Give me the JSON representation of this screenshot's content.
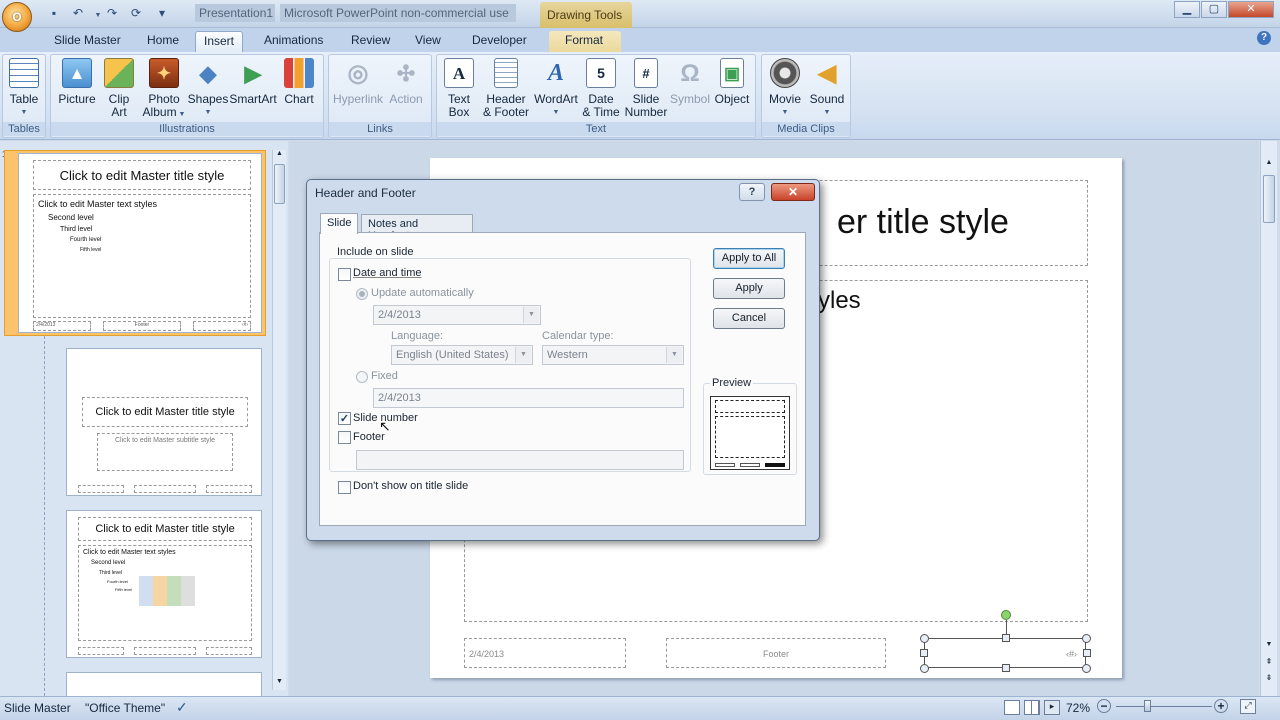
{
  "title_bar": {
    "presentation": "Presentation1",
    "app": "Microsoft PowerPoint non-commercial use",
    "contextual_tools": "Drawing Tools",
    "office_button": "O",
    "quick_access": [
      "save-icon",
      "undo-icon",
      "redo-icon",
      "repeat-icon",
      "customize-icon"
    ],
    "window_controls": [
      "minimize",
      "maximize",
      "close"
    ]
  },
  "tabs": [
    "Slide Master",
    "Home",
    "Insert",
    "Animations",
    "Review",
    "View",
    "Developer",
    "Format"
  ],
  "active_tab": "Insert",
  "ribbon": {
    "groups": [
      {
        "label": "Tables",
        "buttons": [
          {
            "label": "Table",
            "icon": "table-icon"
          }
        ]
      },
      {
        "label": "Illustrations",
        "buttons": [
          {
            "label": "Picture",
            "icon": "picture-icon"
          },
          {
            "label": "Clip",
            "label2": "Art",
            "icon": "clip-art-icon"
          },
          {
            "label": "Photo",
            "label2": "Album",
            "icon": "photo-album-icon"
          },
          {
            "label": "Shapes",
            "icon": "shapes-icon"
          },
          {
            "label": "SmartArt",
            "icon": "smartart-icon"
          },
          {
            "label": "Chart",
            "icon": "chart-icon"
          }
        ]
      },
      {
        "label": "Links",
        "buttons": [
          {
            "label": "Hyperlink",
            "icon": "hyperlink-icon",
            "disabled": true
          },
          {
            "label": "Action",
            "icon": "action-icon",
            "disabled": true
          }
        ]
      },
      {
        "label": "Text",
        "buttons": [
          {
            "label": "Text",
            "label2": "Box",
            "icon": "text-box-icon"
          },
          {
            "label": "Header",
            "label2": "& Footer",
            "icon": "header-footer-icon"
          },
          {
            "label": "WordArt",
            "icon": "wordart-icon"
          },
          {
            "label": "Date",
            "label2": "& Time",
            "icon": "date-time-icon"
          },
          {
            "label": "Slide",
            "label2": "Number",
            "icon": "slide-number-icon"
          },
          {
            "label": "Symbol",
            "icon": "symbol-icon",
            "disabled": true
          },
          {
            "label": "Object",
            "icon": "object-icon"
          }
        ]
      },
      {
        "label": "Media Clips",
        "buttons": [
          {
            "label": "Movie",
            "icon": "movie-icon"
          },
          {
            "label": "Sound",
            "icon": "sound-icon"
          }
        ]
      }
    ]
  },
  "thumbnails": {
    "master": {
      "number": "1",
      "title": "Click to edit Master title style",
      "levels": [
        "Click to edit Master text styles",
        "Second level",
        "Third level",
        "Fourth level",
        "Fifth level"
      ],
      "footer_date": "2/4/2013",
      "footer_mid": "Footer",
      "footer_num": "‹#›"
    },
    "title_layout": {
      "title": "Click to edit Master title style",
      "subtitle": "Click to edit Master subtitle style"
    },
    "content_layout": {
      "title": "Click to edit Master title style",
      "levels": [
        "Click to edit Master text styles",
        "Second level",
        "Third level",
        "Fourth level",
        "Fifth level"
      ]
    }
  },
  "slide": {
    "title_fragment": "er title style",
    "body_fragment": "yles",
    "footer_date": "2/4/2013",
    "footer_text": "Footer",
    "footer_number": "‹#›"
  },
  "dialog": {
    "title": "Header and Footer",
    "help_label": "?",
    "close_label": "✕",
    "tabs": [
      "Slide",
      "Notes and Handouts"
    ],
    "active_tab": "Slide",
    "include_label": "Include on slide",
    "date_time": {
      "label": "Date and time",
      "checked": false
    },
    "update_auto": {
      "label": "Update automatically",
      "selected": true
    },
    "update_value": "2/4/2013",
    "language_label": "Language:",
    "language_value": "English (United States)",
    "calendar_label": "Calendar type:",
    "calendar_value": "Western",
    "fixed": {
      "label": "Fixed",
      "selected": false
    },
    "fixed_value": "2/4/2013",
    "slide_number": {
      "label": "Slide number",
      "checked": true
    },
    "footer": {
      "label": "Footer",
      "checked": false
    },
    "footer_value": "",
    "dont_show": {
      "label": "Don't show on title slide",
      "checked": false
    },
    "buttons": {
      "apply_all": "Apply to All",
      "apply": "Apply",
      "cancel": "Cancel"
    },
    "preview_label": "Preview"
  },
  "status": {
    "view": "Slide Master",
    "theme": "\"Office Theme\"",
    "zoom": "72%",
    "zoom_out": "−",
    "zoom_in": "+"
  }
}
